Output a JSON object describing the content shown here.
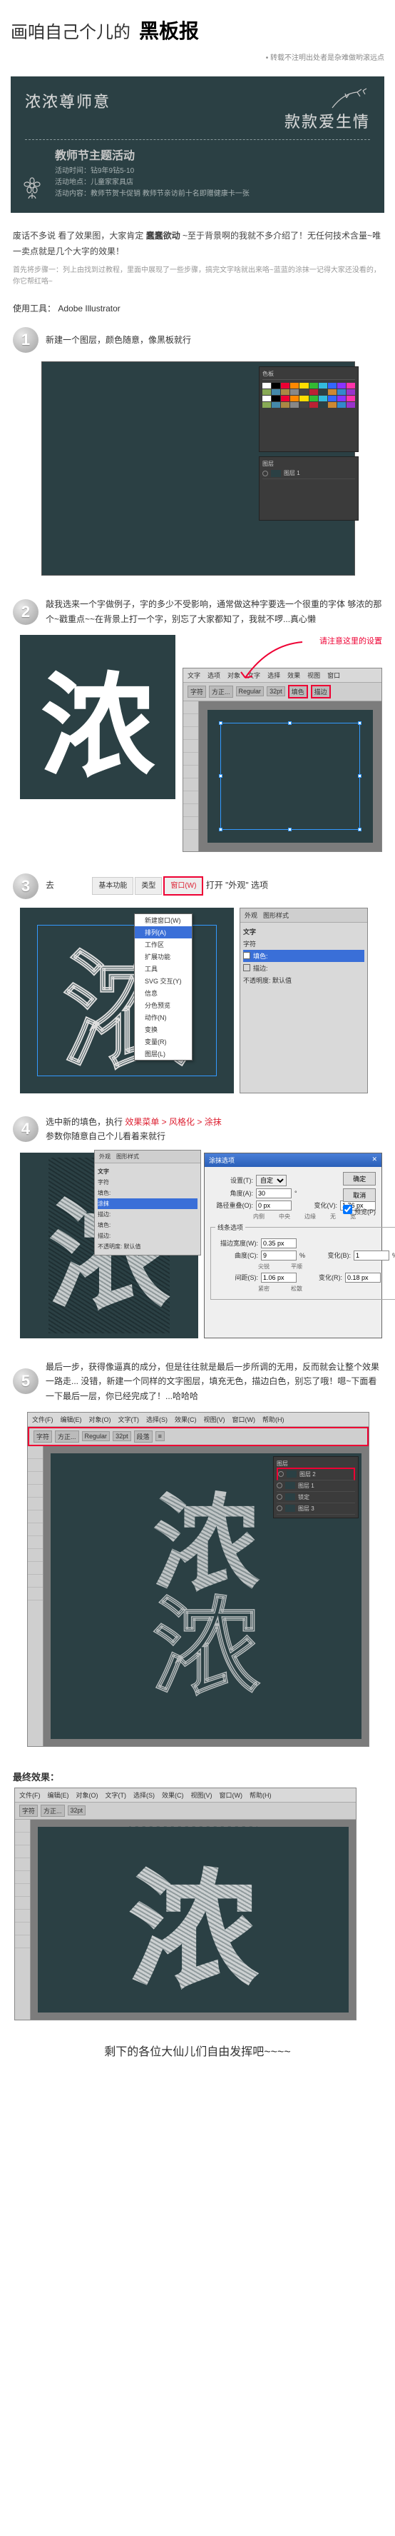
{
  "header": {
    "title_light": "画咱自己个儿的",
    "title_bold": "黑板报",
    "sub_note": "• 转载不注明出处者是杂难做哟滚远点"
  },
  "chalkboard": {
    "line1": "浓浓尊师意",
    "line2": "款款爱生情",
    "event_title": "教师节主题活动",
    "meta1": "活动时间：钻9年9钻5-10",
    "meta2": "活动地点：儿童家家具店",
    "meta3": "活动内容：教师节贺卡促销 教师节亲访前十名即赠健康卡一张"
  },
  "intro": {
    "p1_a": "废话不多说 看了效果图，大家肯定",
    "p1_b": "蠢蠢欲动",
    "p1_c": "~至于背景啊的我就不多介绍了！无任何技术含量~唯一卖点就是几个大字的效果！",
    "p2": "首先将步骤一：列上由找到过教程，里面中展现了一些步骤，搞完文字啥就出来咯~蓝蓝的涂抹一记得大家还没看的，你它帮红咯~"
  },
  "tool": {
    "label": "使用工具：",
    "name": "Adobe Illustrator"
  },
  "steps": {
    "s1": {
      "num": "1",
      "text": "新建一个图层，颜色随意，像黑板就行"
    },
    "s2": {
      "num": "2",
      "text": "敲我选来一个字做例子，字的多少不受影响，通常做这种字要选一个很重的字体  够浓的那个~戳重点~~在背景上打一个字，别忘了大家都知了，我就不啰...真心懒"
    },
    "s2_callout": "请注意这里的设置",
    "s2_menus": [
      "文字",
      "选项",
      "对象",
      "文字",
      "选择",
      "效果",
      "视图",
      "窗口"
    ],
    "s2_toolbar": [
      "字符",
      "方正...",
      "Regular",
      "32pt",
      "填色",
      "描边"
    ],
    "s3": {
      "num": "3",
      "text_a": "去 ",
      "text_b": " 打开 \"外观\" 选项"
    },
    "s3_menu": [
      "基本功能",
      "类型",
      "窗口(W)"
    ],
    "s3_dropdown": [
      "新建窗口(W)",
      "排列(A)",
      "工作区",
      "扩展功能",
      "工具",
      "SVG 交互(Y)",
      "信息",
      "分色预览",
      "动作(N)",
      "变换",
      "变量(R)",
      "图层(L)"
    ],
    "s3_panel_tabs": [
      "外观",
      "图形样式"
    ],
    "s3_panel_header": "文字",
    "s3_rows": [
      "字符",
      "填色:",
      "描边:",
      "不透明度: 默认值"
    ],
    "s4": {
      "num": "4",
      "text_a": "选中新的填色，执行 ",
      "red": "效果菜单 > 风格化 > 涂抹",
      "text_b": "参数你随意自己个儿看着来就行"
    },
    "s4_dialog_title": "涂抹选项",
    "s4_dialog": {
      "preset_label": "设置(T):",
      "preset_val": "自定",
      "angle_label": "角度(A):",
      "angle_val": "30",
      "overlap_label": "路径重叠(O):",
      "overlap_val": "0 px",
      "overlap_var_label": "变化(V):",
      "overlap_var_val": "1.76 px",
      "inside": "内侧",
      "center": "中央",
      "edge": "边缘",
      "none": "无",
      "wide": "宽",
      "line_group": "线条选项",
      "stroke_label": "描边宽度(W):",
      "stroke_val": "0.35 px",
      "curve_label": "曲度(C):",
      "curve_val": "9",
      "curve_var_label": "变化(B):",
      "curve_var_val": "1",
      "space_label": "间距(S):",
      "space_val": "1.06 px",
      "space_var_label": "变化(R):",
      "space_var_val": "0.18 px",
      "tight": "紧密",
      "loose": "松散",
      "sharp": "尖锐",
      "round": "平顺",
      "ok": "确定",
      "cancel": "取消",
      "preview": "预览(P)"
    },
    "s4_mini_tabs": [
      "外观",
      "图形样式"
    ],
    "s4_mini_header": "文字",
    "s4_mini_rows": [
      "字符",
      "填色:",
      "涂抹",
      "描边:",
      "填色:",
      "描边:",
      "不透明度: 默认值"
    ],
    "s5": {
      "num": "5",
      "text": "最后一步，获得像逼真的成分，但是往往就是最后一步所调的无用，反而就会让整个效果一路走... 没错，新建一个同样的文字图层，填充无色，描边白色，别忘了哦！嗯~下面看一下最后一层，你已经完成了！...哈哈哈"
    },
    "s5_menus": [
      "文件(F)",
      "编辑(E)",
      "对象(O)",
      "文字(T)",
      "选择(S)",
      "效果(C)",
      "视图(V)",
      "窗口(W)",
      "帮助(H)"
    ],
    "s5_layer_rows": [
      "图层 2",
      "图层 1",
      "锁定",
      "图层 3"
    ]
  },
  "big_char": "浓",
  "final": {
    "label": "最终效果："
  },
  "outro": "剩下的各位大仙儿们自由发挥吧~~~~",
  "colors": {
    "board": "#2b4044",
    "red": "#e03",
    "blue": "#3a6fd8"
  },
  "swatches": [
    "#fff",
    "#000",
    "#e03",
    "#f80",
    "#fd0",
    "#3b3",
    "#3bd",
    "#36f",
    "#83f",
    "#f3a",
    "#8a5",
    "#48a",
    "#a84",
    "#888",
    "#444",
    "#b23",
    "#2b4044",
    "#c83",
    "#38c",
    "#93c"
  ]
}
